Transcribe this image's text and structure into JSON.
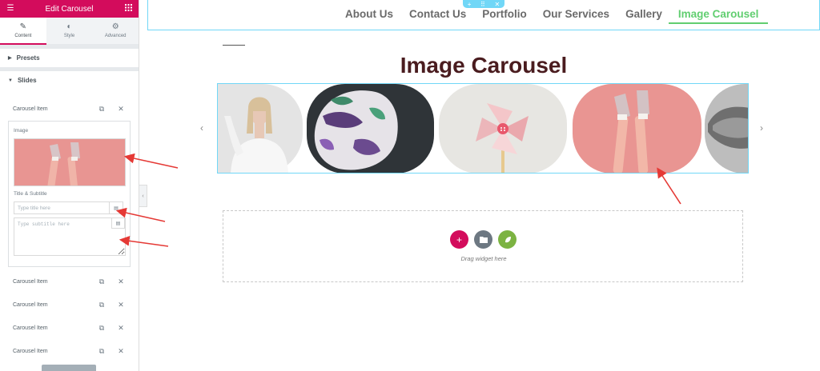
{
  "panel": {
    "title": "Edit Carousel",
    "tabs": [
      {
        "label": "Content",
        "icon": "pencil-icon"
      },
      {
        "label": "Style",
        "icon": "contrast-icon"
      },
      {
        "label": "Advanced",
        "icon": "gear-icon"
      }
    ],
    "sections": {
      "presets": "Presets",
      "slides": "Slides"
    },
    "expanded_item": {
      "label": "Carousel Item",
      "image_label": "Image",
      "title_subtitle_label": "Title & Subtitle",
      "title_placeholder": "Type title here",
      "subtitle_placeholder": "Type subtitle here"
    },
    "items": [
      "Carousel Item",
      "Carousel Item",
      "Carousel Item",
      "Carousel Item"
    ],
    "accent_color": "#d30c5c"
  },
  "nav": {
    "items": [
      "About Us",
      "Contact Us",
      "Portfolio",
      "Our Services",
      "Gallery",
      "Image Carousel"
    ],
    "active": "Image Carousel",
    "active_color": "#61ce70"
  },
  "carousel": {
    "title": "Image Carousel",
    "slides": [
      "woman-white-shirt",
      "painted-face",
      "pink-pinwheel",
      "legs-sneakers-pink",
      "monochrome-hand"
    ]
  },
  "drop_zone": {
    "text": "Drag widget here",
    "buttons": [
      {
        "icon": "plus-icon",
        "color": "#d30c5c"
      },
      {
        "icon": "folder-icon",
        "color": "#6d7882"
      },
      {
        "icon": "leaf-icon",
        "color": "#7cb342"
      }
    ]
  }
}
